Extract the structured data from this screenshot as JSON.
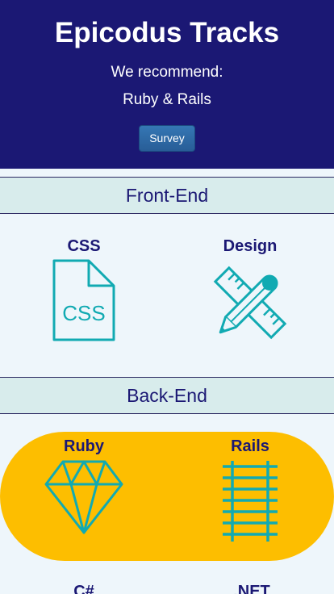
{
  "header": {
    "title": "Epicodus Tracks",
    "recommend_label": "We recommend:",
    "recommended_track": "Ruby & Rails",
    "survey_button": "Survey"
  },
  "sections": [
    {
      "title": "Front-End",
      "items": [
        {
          "label": "CSS",
          "icon": "css-file-icon",
          "icon_text": "CSS"
        },
        {
          "label": "Design",
          "icon": "pencil-ruler-icon"
        }
      ]
    },
    {
      "title": "Back-End",
      "items": [
        {
          "label": "Ruby",
          "icon": "ruby-gem-icon",
          "highlighted": true
        },
        {
          "label": "Rails",
          "icon": "rails-track-icon",
          "highlighted": true
        },
        {
          "label": "C#"
        },
        {
          "label": ".NET"
        }
      ]
    }
  ],
  "colors": {
    "header_bg": "#1b1874",
    "accent_teal": "#11aab2",
    "highlight": "#fdbe00",
    "page_bg": "#eef6fb",
    "section_bar_bg": "#d8ecec"
  }
}
